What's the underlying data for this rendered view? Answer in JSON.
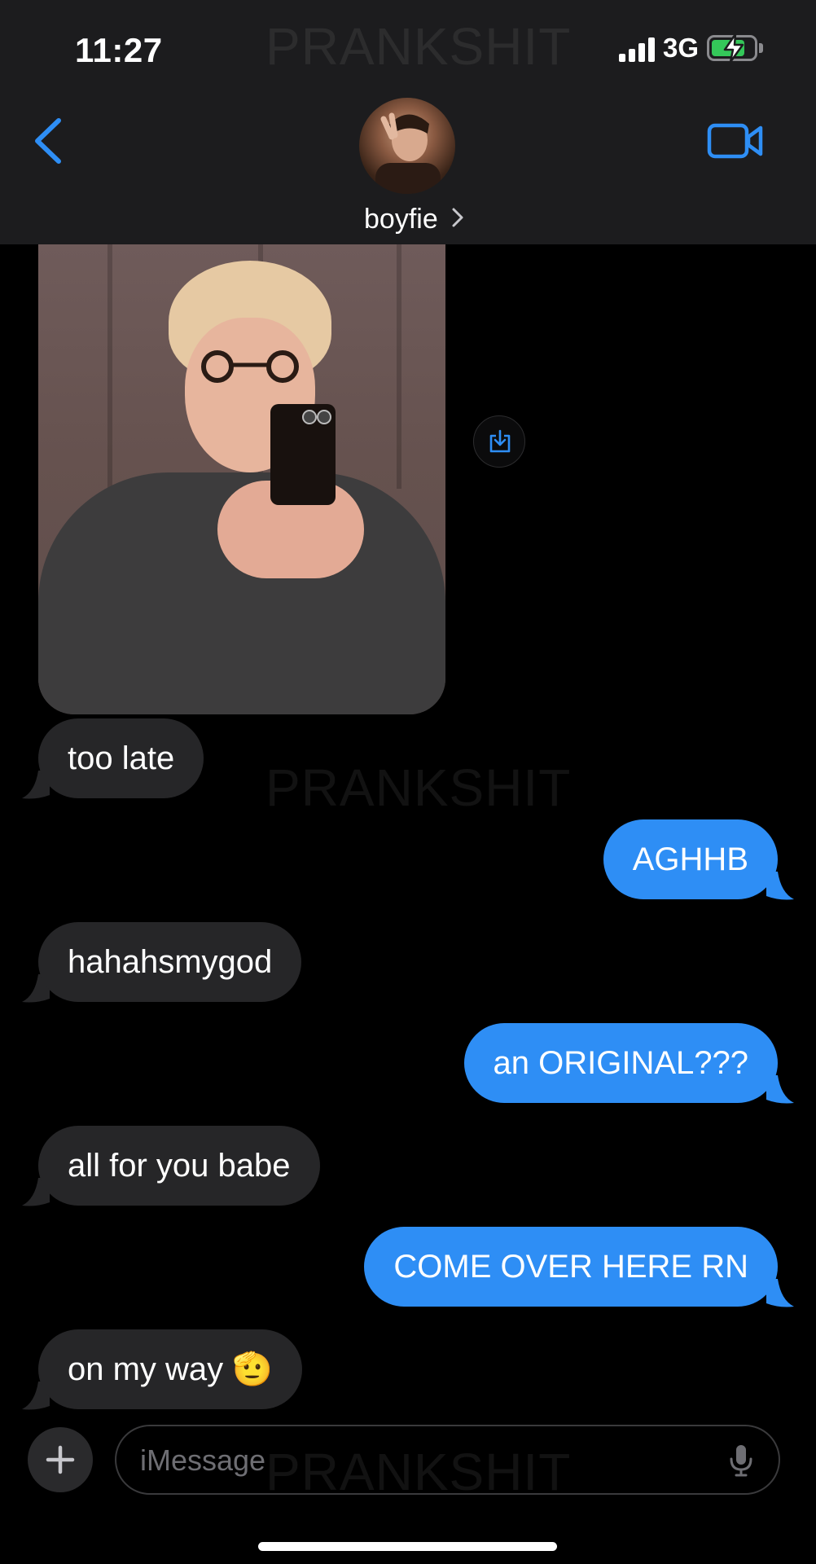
{
  "status_bar": {
    "time": "11:27",
    "network": "3G",
    "battery_level": 0.8,
    "charging": true
  },
  "header": {
    "contact_name": "boyfie",
    "back_icon": "chevron-left-icon",
    "video_icon": "video-camera-icon"
  },
  "watermark": "PRANKSHIT",
  "messages": [
    {
      "side": "received",
      "text": "too late"
    },
    {
      "side": "sent",
      "text": "AGHHB"
    },
    {
      "side": "received",
      "text": "hahahsmygod"
    },
    {
      "side": "sent",
      "text": "an ORIGINAL???"
    },
    {
      "side": "received",
      "text": "all for you babe"
    },
    {
      "side": "sent",
      "text": "COME OVER HERE RN"
    },
    {
      "side": "received",
      "text": "on my way 🫡"
    }
  ],
  "input": {
    "placeholder": "iMessage"
  },
  "colors": {
    "accent": "#2e8ef5",
    "received_bubble": "#262628",
    "header_bg": "#1c1c1e",
    "battery_green": "#34c759"
  }
}
